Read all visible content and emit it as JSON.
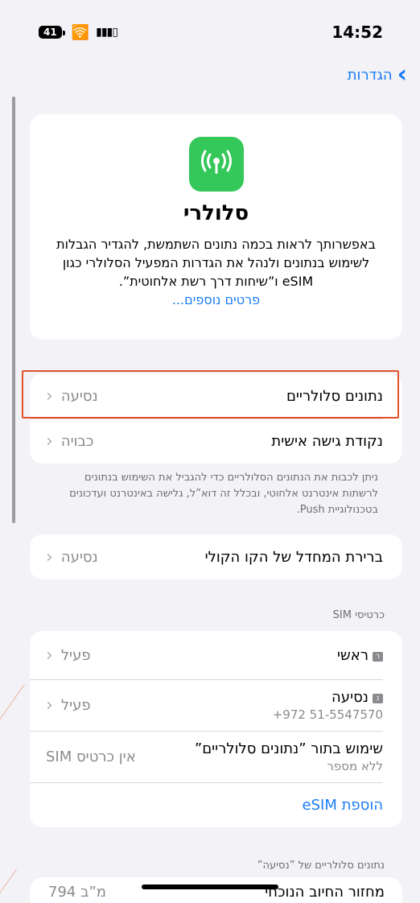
{
  "status": {
    "battery": "41",
    "time": "14:52"
  },
  "nav": {
    "back_label": "הגדרות"
  },
  "header": {
    "title": "סלולרי",
    "description": "באפשרותך לראות בכמה נתונים השתמשת, להגדיר הגבלות לשימוש בנתונים ולנהל את הגדרות המפעיל הסלולרי כגון eSIM ו”שיחות דרך רשת אלחוטית”.",
    "more_link": "פרטים נוספים..."
  },
  "group1": {
    "cellular_data": {
      "label": "נתונים סלולריים",
      "value": "נסיעה"
    },
    "hotspot": {
      "label": "נקודת גישה אישית",
      "value": "כבויה"
    }
  },
  "group1_note": "ניתן לכבות את הנתונים הסלולריים כדי להגביל את השימוש בנתונים לרשתות אינטרנט אלחוטי, ובכלל זה דוא”ל, גלישה באינטרנט ועדכונים בטכנולוגיית Push.",
  "default_voice": {
    "label": "ברירת המחדל של הקו הקולי",
    "value": "נסיעה"
  },
  "sim_section": {
    "header": "כרטיסי SIM",
    "primary": {
      "badge": "ר",
      "label": "ראשי",
      "value": "פעיל"
    },
    "travel": {
      "badge": "נ",
      "label": "נסיעה",
      "number": "+972 51-5547570",
      "value": "פעיל"
    },
    "no_number": {
      "label": "שימוש בתור ”נתונים סלולריים”",
      "sub": "ללא מספר",
      "value": "אין כרטיס SIM"
    },
    "add_esim": "הוספת eSIM"
  },
  "travel_data_section": {
    "header": "נתונים סלולריים של ”נסיעה”",
    "current_period": {
      "label": "מחזור החיוב הנוכחי",
      "value": "794 מ”ב"
    }
  },
  "colors": {
    "accent": "#1a7cf5",
    "icon_bg": "#34c759",
    "highlight": "#e2522a"
  }
}
